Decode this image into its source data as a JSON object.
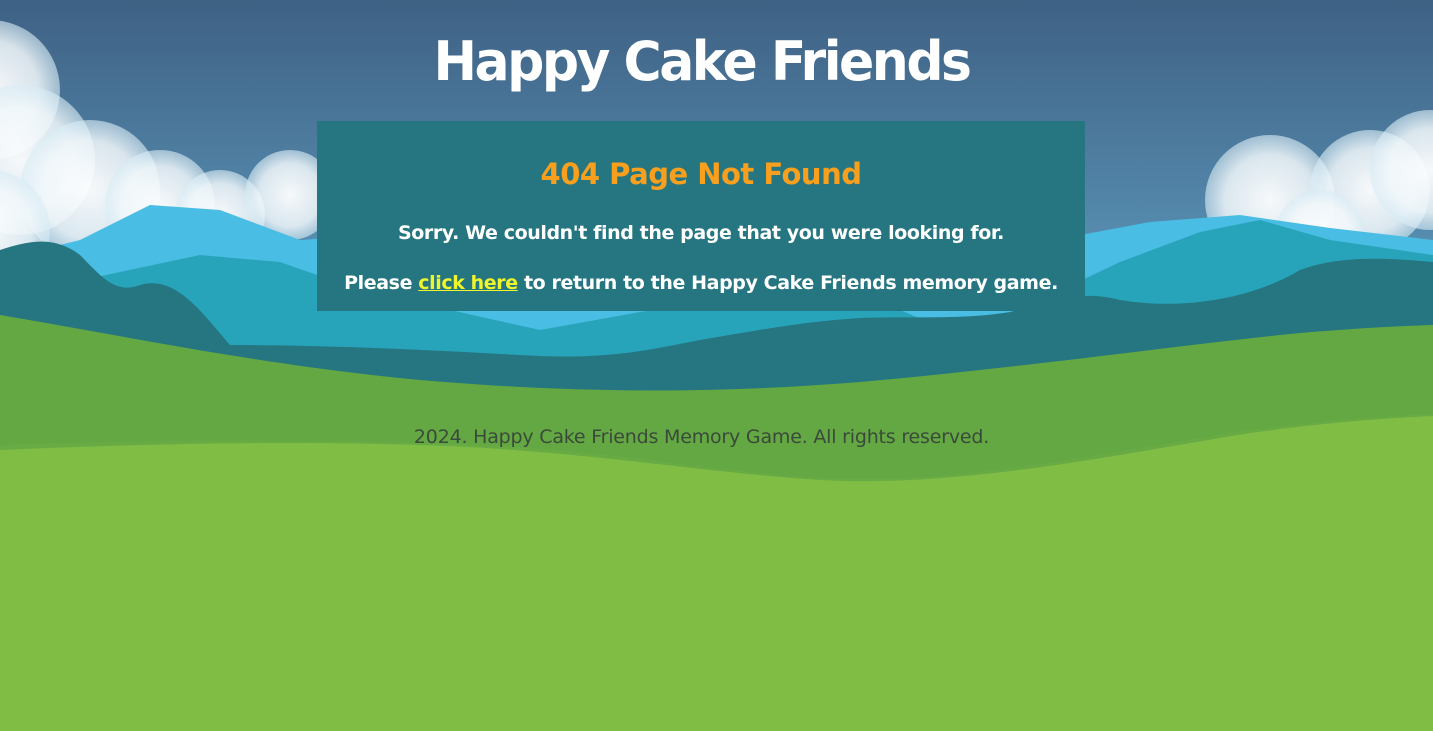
{
  "header": {
    "title": "Happy Cake Friends"
  },
  "notice": {
    "heading": "404 Page Not Found",
    "message": "Sorry. We couldn't find the page that you were looking for.",
    "prompt_before": "Please ",
    "link_label": "click here",
    "prompt_after": " to return to the Happy Cake Friends memory game."
  },
  "footer": {
    "copyright": "2024. Happy Cake Friends Memory Game. All rights reserved."
  },
  "colors": {
    "box_background": "#257681",
    "heading": "#f8a01e",
    "link": "#eef52a",
    "grass": "#7fbd44",
    "sky_top": "#3e6184"
  }
}
